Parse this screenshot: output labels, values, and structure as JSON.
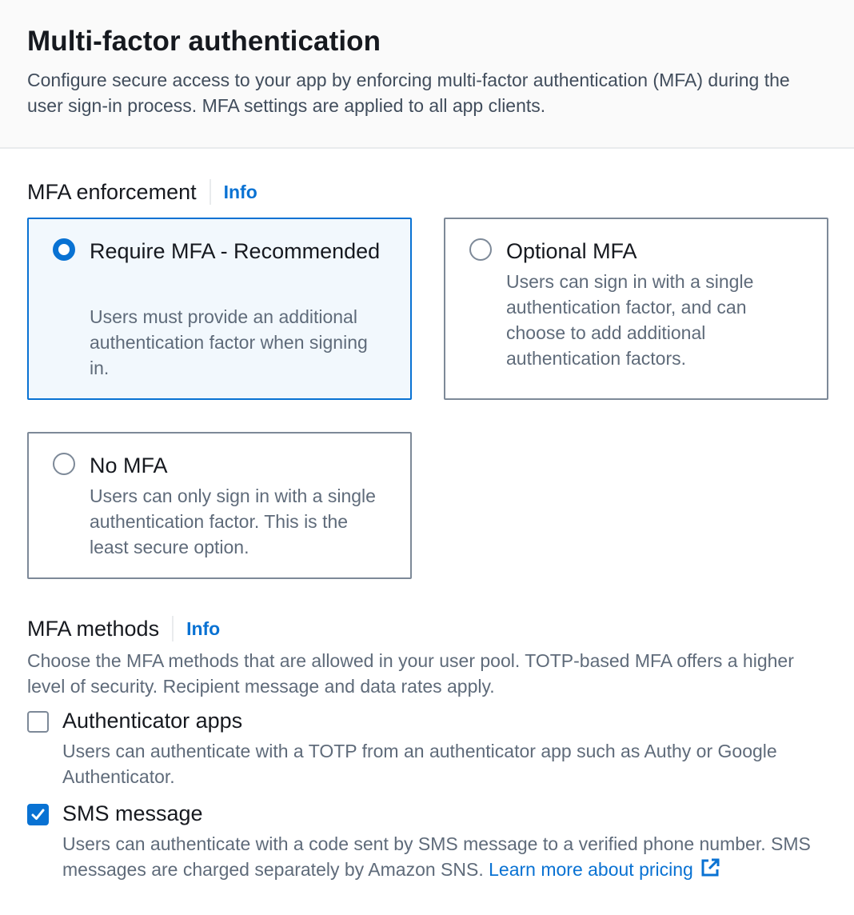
{
  "header": {
    "title": "Multi-factor authentication",
    "description": "Configure secure access to your app by enforcing multi-factor authentication (MFA) during the user sign-in process. MFA settings are applied to all app clients."
  },
  "enforcement": {
    "label": "MFA enforcement",
    "info": "Info",
    "selected": "require",
    "options": [
      {
        "id": "require",
        "title": "Require MFA - Recommended",
        "description": "Users must provide an additional authentication factor when signing in."
      },
      {
        "id": "optional",
        "title": "Optional MFA",
        "description": "Users can sign in with a single authentication factor, and can choose to add additional authentication factors."
      },
      {
        "id": "none",
        "title": "No MFA",
        "description": "Users can only sign in with a single authentication factor. This is the least secure option."
      }
    ]
  },
  "methods": {
    "label": "MFA methods",
    "info": "Info",
    "description": "Choose the MFA methods that are allowed in your user pool. TOTP-based MFA offers a higher level of security. Recipient message and data rates apply.",
    "items": [
      {
        "title": "Authenticator apps",
        "description": "Users can authenticate with a TOTP from an authenticator app such as Authy or Google Authenticator.",
        "checked": false
      },
      {
        "title": "SMS message",
        "description": "Users can authenticate with a code sent by SMS message to a verified phone number. SMS messages are charged separately by Amazon SNS.",
        "checked": true,
        "link_text": "Learn more about pricing",
        "link_icon": "external-link-icon"
      }
    ]
  },
  "colors": {
    "accent": "#0972d3",
    "selected_bg": "#f2f8fd",
    "border": "#7d8998",
    "secondary_text": "#5f6b7a"
  }
}
